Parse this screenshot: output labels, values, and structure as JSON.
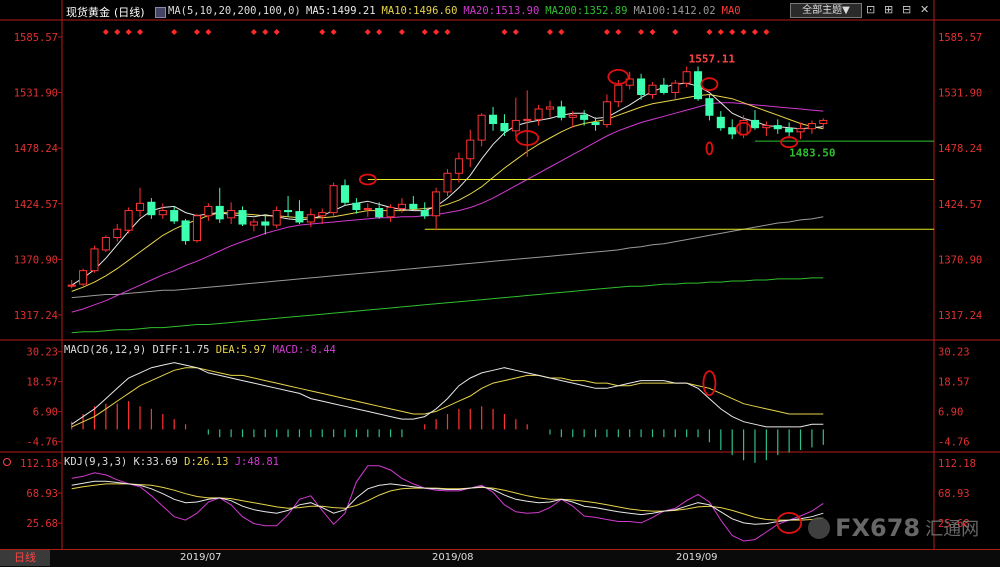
{
  "header": {
    "instrument": "现货黄金",
    "period": "(日线)",
    "ma_params": "MA(5,10,20,200,100,0)",
    "ma_values": [
      {
        "label": "MA5:1499.21",
        "color": "#e8e8e8"
      },
      {
        "label": "MA10:1496.60",
        "color": "#e8d44a"
      },
      {
        "label": "MA20:1513.90",
        "color": "#d23ad2"
      },
      {
        "label": "MA200:1352.89",
        "color": "#2fbf2f"
      },
      {
        "label": "MA100:1412.02",
        "color": "#9a9a9a"
      },
      {
        "label": "MA0",
        "color": "#ff3a3a"
      }
    ],
    "theme_button": "全部主题▼",
    "win_buttons": [
      "⊡",
      "⊞",
      "⊟",
      "✕"
    ]
  },
  "macd": {
    "label": "MACD(26,12,9)",
    "diff": "DIFF:1.75",
    "dea": "DEA:5.97",
    "macd": "MACD:-8.44"
  },
  "kdj": {
    "label": "KDJ(9,3,3)",
    "k": "K:33.69",
    "d": "D:26.13",
    "j": "J:48.81"
  },
  "footer": {
    "period_tab": "日线",
    "dates": [
      "2019/07",
      "2019/08",
      "2019/09"
    ]
  },
  "watermark": {
    "text": "FX678",
    "cn": "汇通网"
  },
  "colors": {
    "up": "#ff3333",
    "down": "#3dffb0",
    "axis": "#b31b1b",
    "hline": "#e8e820"
  },
  "chart_data": [
    {
      "type": "candlestick",
      "y_ticks": [
        1585.57,
        1531.9,
        1478.24,
        1424.57,
        1370.9,
        1317.24
      ],
      "ylim": [
        1295,
        1600
      ],
      "annotations": [
        "1557.11",
        "1483.50"
      ],
      "ohlc": [
        [
          1345,
          1351,
          1343,
          1346
        ],
        [
          1347,
          1362,
          1345,
          1360
        ],
        [
          1360,
          1384,
          1358,
          1381
        ],
        [
          1380,
          1394,
          1378,
          1392
        ],
        [
          1392,
          1405,
          1388,
          1400
        ],
        [
          1399,
          1421,
          1396,
          1418
        ],
        [
          1418,
          1440,
          1412,
          1425
        ],
        [
          1426,
          1430,
          1410,
          1414
        ],
        [
          1414,
          1425,
          1410,
          1418
        ],
        [
          1418,
          1422,
          1405,
          1408
        ],
        [
          1408,
          1410,
          1385,
          1389
        ],
        [
          1389,
          1415,
          1387,
          1413
        ],
        [
          1413,
          1425,
          1408,
          1422
        ],
        [
          1422,
          1440,
          1406,
          1410
        ],
        [
          1411,
          1426,
          1405,
          1418
        ],
        [
          1418,
          1422,
          1403,
          1405
        ],
        [
          1404,
          1410,
          1398,
          1407
        ],
        [
          1407,
          1414,
          1395,
          1404
        ],
        [
          1404,
          1422,
          1401,
          1418
        ],
        [
          1418,
          1432,
          1412,
          1417
        ],
        [
          1417,
          1428,
          1405,
          1407
        ],
        [
          1407,
          1420,
          1402,
          1414
        ],
        [
          1413,
          1420,
          1405,
          1416
        ],
        [
          1416,
          1445,
          1413,
          1442
        ],
        [
          1442,
          1448,
          1423,
          1426
        ],
        [
          1425,
          1430,
          1415,
          1419
        ],
        [
          1419,
          1425,
          1412,
          1420
        ],
        [
          1420,
          1426,
          1410,
          1412
        ],
        [
          1412,
          1424,
          1407,
          1421
        ],
        [
          1420,
          1430,
          1416,
          1424
        ],
        [
          1424,
          1432,
          1418,
          1420
        ],
        [
          1418,
          1426,
          1410,
          1413
        ],
        [
          1413,
          1440,
          1399,
          1436
        ],
        [
          1436,
          1458,
          1432,
          1454
        ],
        [
          1454,
          1474,
          1445,
          1468
        ],
        [
          1468,
          1496,
          1460,
          1486
        ],
        [
          1486,
          1512,
          1480,
          1510
        ],
        [
          1510,
          1518,
          1495,
          1502
        ],
        [
          1502,
          1511,
          1490,
          1495
        ],
        [
          1495,
          1527,
          1490,
          1505
        ],
        [
          1505,
          1534,
          1470,
          1506
        ],
        [
          1506,
          1520,
          1500,
          1516
        ],
        [
          1516,
          1524,
          1508,
          1518
        ],
        [
          1518,
          1524,
          1505,
          1508
        ],
        [
          1508,
          1514,
          1498,
          1510
        ],
        [
          1510,
          1515,
          1500,
          1506
        ],
        [
          1503,
          1508,
          1495,
          1501
        ],
        [
          1501,
          1530,
          1498,
          1523
        ],
        [
          1523,
          1544,
          1518,
          1539
        ],
        [
          1539,
          1552,
          1535,
          1545
        ],
        [
          1545,
          1550,
          1525,
          1530
        ],
        [
          1530,
          1542,
          1526,
          1539
        ],
        [
          1539,
          1546,
          1530,
          1532
        ],
        [
          1532,
          1544,
          1526,
          1541
        ],
        [
          1541,
          1557,
          1537,
          1552
        ],
        [
          1552,
          1557,
          1524,
          1526
        ],
        [
          1526,
          1530,
          1505,
          1510
        ],
        [
          1508,
          1514,
          1495,
          1498
        ],
        [
          1498,
          1506,
          1487,
          1492
        ],
        [
          1491,
          1510,
          1488,
          1505
        ],
        [
          1505,
          1515,
          1496,
          1498
        ],
        [
          1498,
          1504,
          1490,
          1500
        ],
        [
          1500,
          1506,
          1492,
          1497
        ],
        [
          1497,
          1503,
          1488,
          1494
        ],
        [
          1494,
          1503,
          1487,
          1497
        ],
        [
          1497,
          1505,
          1492,
          1502
        ],
        [
          1502,
          1507,
          1497,
          1505
        ]
      ],
      "ma5": [
        1346,
        1353,
        1361,
        1372,
        1385,
        1398,
        1410,
        1418,
        1421,
        1422,
        1416,
        1413,
        1415,
        1416,
        1414,
        1413,
        1412,
        1414,
        1412,
        1410,
        1409,
        1410,
        1413,
        1418,
        1423,
        1425,
        1427,
        1424,
        1421,
        1419,
        1418,
        1418,
        1422,
        1430,
        1440,
        1452,
        1468,
        1482,
        1493,
        1500,
        1503,
        1505,
        1507,
        1510,
        1512,
        1512,
        1507,
        1508,
        1514,
        1520,
        1527,
        1533,
        1537,
        1540,
        1541,
        1538,
        1532,
        1522,
        1512,
        1507,
        1504,
        1500,
        1499,
        1498,
        1497,
        1498,
        1499
      ],
      "ma10": [
        1340,
        1344,
        1349,
        1355,
        1362,
        1370,
        1378,
        1386,
        1394,
        1400,
        1405,
        1409,
        1413,
        1416,
        1416,
        1415,
        1414,
        1413,
        1413,
        1412,
        1411,
        1411,
        1411,
        1412,
        1414,
        1416,
        1418,
        1418,
        1418,
        1418,
        1419,
        1420,
        1421,
        1424,
        1428,
        1434,
        1441,
        1450,
        1459,
        1467,
        1475,
        1482,
        1488,
        1494,
        1499,
        1502,
        1504,
        1506,
        1510,
        1514,
        1518,
        1521,
        1523,
        1525,
        1527,
        1529,
        1530,
        1528,
        1526,
        1522,
        1518,
        1514,
        1510,
        1506,
        1502,
        1499,
        1497
      ],
      "ma20": [
        1320,
        1323,
        1327,
        1331,
        1336,
        1341,
        1346,
        1351,
        1356,
        1360,
        1365,
        1369,
        1374,
        1379,
        1384,
        1388,
        1392,
        1396,
        1399,
        1402,
        1404,
        1405,
        1406,
        1407,
        1408,
        1409,
        1410,
        1411,
        1411,
        1412,
        1412,
        1413,
        1414,
        1416,
        1418,
        1421,
        1425,
        1430,
        1436,
        1442,
        1448,
        1454,
        1460,
        1466,
        1472,
        1478,
        1484,
        1490,
        1495,
        1499,
        1503,
        1506,
        1509,
        1512,
        1515,
        1518,
        1521,
        1522,
        1522,
        1521,
        1520,
        1519,
        1518,
        1517,
        1516,
        1515,
        1514
      ],
      "ma100": [
        1334,
        1335,
        1336,
        1337,
        1337,
        1338,
        1339,
        1340,
        1341,
        1341,
        1342,
        1343,
        1344,
        1345,
        1346,
        1347,
        1348,
        1349,
        1350,
        1351,
        1352,
        1353,
        1354,
        1355,
        1356,
        1357,
        1358,
        1359,
        1360,
        1361,
        1362,
        1363,
        1364,
        1365,
        1366,
        1367,
        1368,
        1369,
        1370,
        1371,
        1372,
        1373,
        1374,
        1375,
        1376,
        1377,
        1378,
        1379,
        1380,
        1382,
        1383,
        1385,
        1386,
        1388,
        1390,
        1392,
        1394,
        1396,
        1398,
        1400,
        1402,
        1404,
        1406,
        1407,
        1409,
        1410,
        1412
      ],
      "ma200": [
        1300,
        1301,
        1301,
        1302,
        1303,
        1303,
        1304,
        1305,
        1305,
        1306,
        1307,
        1308,
        1308,
        1309,
        1310,
        1311,
        1312,
        1313,
        1314,
        1315,
        1316,
        1317,
        1318,
        1319,
        1320,
        1321,
        1322,
        1323,
        1324,
        1325,
        1326,
        1327,
        1328,
        1329,
        1330,
        1331,
        1332,
        1333,
        1334,
        1335,
        1336,
        1337,
        1338,
        1339,
        1340,
        1341,
        1342,
        1343,
        1344,
        1345,
        1345,
        1346,
        1347,
        1347,
        1348,
        1348,
        1349,
        1349,
        1350,
        1350,
        1351,
        1351,
        1352,
        1352,
        1352,
        1353,
        1353
      ],
      "hlines": [
        1448,
        1400,
        1485
      ]
    },
    {
      "type": "macd",
      "y_ticks": [
        30.23,
        18.57,
        6.9,
        -4.76
      ],
      "ylim": [
        -8,
        34
      ],
      "diff": [
        2,
        5,
        8,
        12,
        16,
        20,
        22,
        24,
        25,
        26,
        25,
        24,
        22,
        21,
        20,
        19,
        18,
        17,
        16,
        15,
        14,
        12,
        11,
        10,
        9,
        8,
        7,
        6,
        5,
        4,
        4,
        5,
        8,
        12,
        17,
        20,
        22,
        23,
        24,
        23,
        22,
        21,
        20,
        19,
        18,
        17,
        16,
        16,
        17,
        18,
        19,
        19,
        19,
        18,
        18,
        16,
        12,
        8,
        5,
        3,
        2,
        1,
        1,
        1,
        1,
        2,
        2
      ],
      "dea": [
        1,
        3,
        5,
        8,
        11,
        14,
        17,
        19,
        21,
        23,
        24,
        24,
        23,
        22,
        21,
        21,
        20,
        19,
        18,
        17,
        16,
        15,
        14,
        13,
        12,
        11,
        10,
        9,
        8,
        7,
        6,
        6,
        7,
        9,
        11,
        13,
        16,
        18,
        19,
        20,
        21,
        21,
        20,
        20,
        19,
        19,
        18,
        18,
        17,
        17,
        18,
        18,
        18,
        18,
        18,
        17,
        16,
        14,
        12,
        10,
        9,
        8,
        7,
        6,
        6,
        6,
        6
      ],
      "hist": [
        3,
        6,
        9,
        10,
        10,
        11,
        9,
        8,
        6,
        4,
        2,
        0,
        -2,
        -3,
        -3,
        -3,
        -3,
        -3,
        -3,
        -3,
        -3,
        -3,
        -3,
        -3,
        -3,
        -3,
        -3,
        -3,
        -3,
        -3,
        0,
        2,
        4,
        6,
        8,
        8,
        9,
        8,
        6,
        4,
        2,
        0,
        -2,
        -3,
        -3,
        -3,
        -3,
        -3,
        -3,
        -3,
        -3,
        -3,
        -3,
        -3,
        -3,
        -3,
        -5,
        -8,
        -10,
        -12,
        -13,
        -12,
        -10,
        -9,
        -8,
        -7,
        -6
      ]
    },
    {
      "type": "kdj",
      "y_ticks": [
        112.18,
        68.93,
        25.68
      ],
      "ylim": [
        -10,
        125
      ],
      "k": [
        80,
        83,
        86,
        86,
        84,
        82,
        80,
        75,
        68,
        60,
        55,
        56,
        60,
        62,
        58,
        50,
        45,
        42,
        40,
        44,
        52,
        55,
        48,
        40,
        45,
        62,
        75,
        80,
        82,
        80,
        78,
        76,
        75,
        74,
        74,
        76,
        78,
        74,
        66,
        60,
        57,
        55,
        56,
        60,
        56,
        50,
        48,
        45,
        42,
        40,
        38,
        40,
        43,
        45,
        50,
        55,
        52,
        42,
        32,
        26,
        24,
        25,
        28,
        30,
        32,
        35,
        40
      ],
      "d": [
        75,
        78,
        80,
        82,
        82,
        82,
        81,
        80,
        77,
        73,
        68,
        64,
        62,
        62,
        61,
        58,
        55,
        52,
        49,
        47,
        48,
        50,
        50,
        48,
        47,
        51,
        58,
        66,
        72,
        75,
        76,
        76,
        76,
        75,
        75,
        76,
        77,
        76,
        73,
        69,
        65,
        62,
        60,
        60,
        59,
        57,
        55,
        52,
        49,
        46,
        44,
        43,
        43,
        44,
        46,
        49,
        50,
        48,
        44,
        39,
        34,
        31,
        30,
        30,
        30,
        31,
        33
      ],
      "j": [
        90,
        93,
        98,
        95,
        88,
        82,
        78,
        65,
        50,
        35,
        30,
        40,
        56,
        62,
        52,
        35,
        25,
        22,
        22,
        38,
        60,
        65,
        44,
        24,
        40,
        85,
        108,
        108,
        102,
        90,
        82,
        76,
        73,
        72,
        72,
        76,
        80,
        70,
        52,
        42,
        40,
        41,
        48,
        60,
        50,
        36,
        34,
        31,
        28,
        28,
        26,
        34,
        43,
        47,
        58,
        67,
        56,
        30,
        8,
        0,
        2,
        13,
        24,
        30,
        36,
        43,
        54
      ]
    }
  ]
}
